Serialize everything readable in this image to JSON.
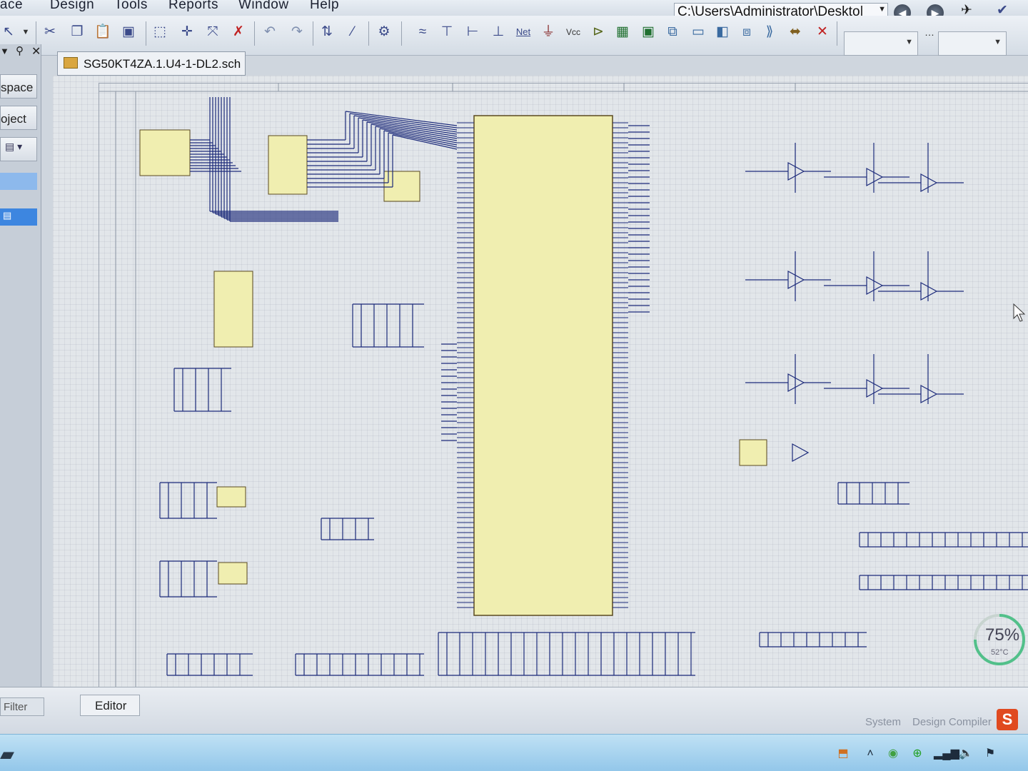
{
  "menubar": {
    "items": [
      {
        "label": "Place",
        "x": "p"
      },
      {
        "label": "Design"
      },
      {
        "label": "Tools"
      },
      {
        "label": "Reports"
      },
      {
        "label": "Window"
      },
      {
        "label": "Help"
      }
    ],
    "path": "C:\\Users\\Administrator\\Deskto|"
  },
  "toolbar": {
    "net_label": "Net",
    "vcc_label": "Vcc",
    "icons": [
      "select-icon",
      "cut-icon",
      "copy-icon",
      "paste-icon",
      "rubber-stamp-icon",
      "select-area-icon",
      "move-icon",
      "deselect-icon",
      "clear-icon",
      "undo-icon",
      "redo-icon",
      "up-down-hierarchy-icon",
      "cross-probe-icon",
      "browse-component-icon",
      "wire-icon",
      "bus-icon",
      "bus-entry-icon",
      "net-label-icon",
      "power-port-icon",
      "part-icon",
      "sheet-symbol-icon",
      "sheet-entry-icon",
      "port-icon",
      "off-sheet-icon",
      "no-erc-icon"
    ]
  },
  "leftpanel": {
    "tabs": [
      "space",
      "oject"
    ]
  },
  "document": {
    "tab_title": "SG50KT4ZA.1.U4-1-DL2.sch"
  },
  "bottombar": {
    "filter_label": "Filter",
    "editor_label": "Editor",
    "status_items": [
      "System",
      "Design Compiler"
    ]
  },
  "gauge": {
    "percent": "75%",
    "temperature": "52°C"
  },
  "colors": {
    "component_fill": "#f0eeb0",
    "wire": "#1c2a7a",
    "sheet_bg": "#e2e6ea"
  }
}
